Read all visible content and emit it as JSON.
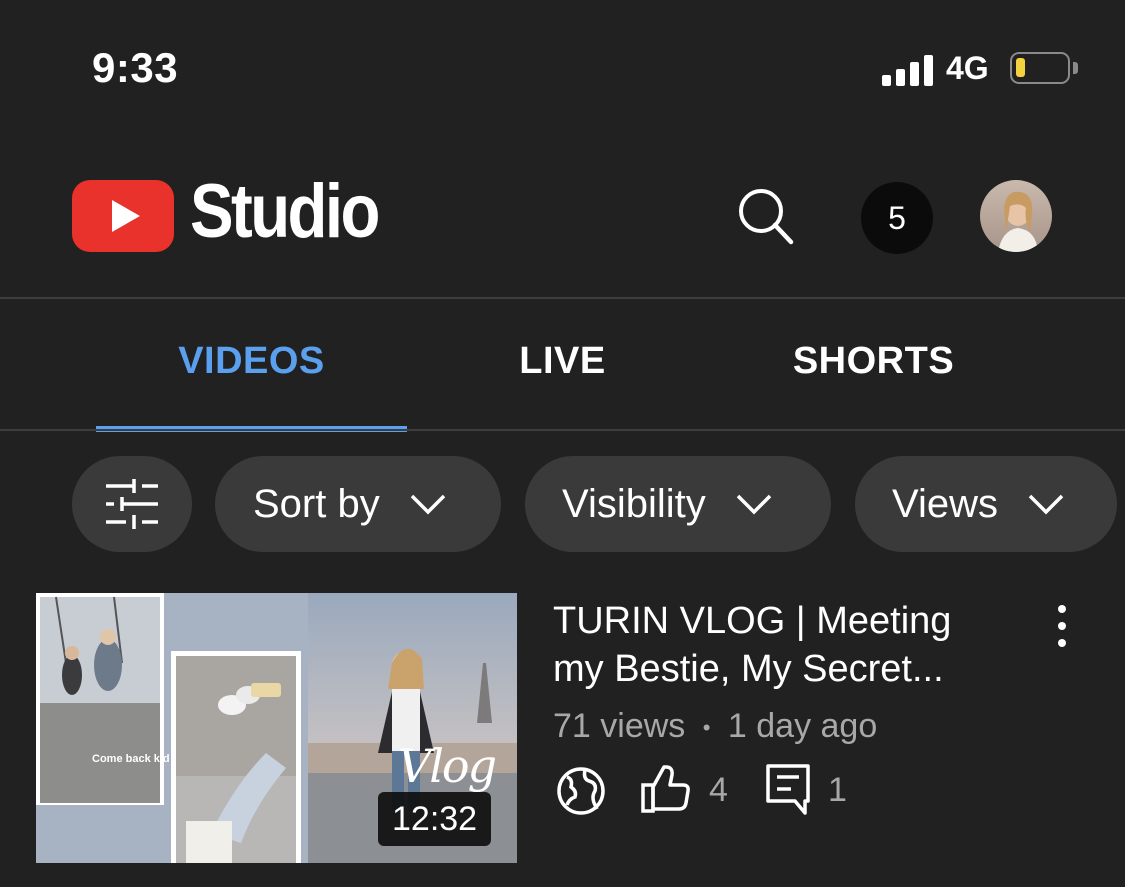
{
  "status_bar": {
    "time": "9:33",
    "network": "4G",
    "signal_bars": 4,
    "battery_level": 0.2,
    "battery_color": "#f4d13e"
  },
  "header": {
    "app_name": "Studio",
    "logo_color": "#e8322b",
    "notification_count": "5"
  },
  "tabs": [
    {
      "label": "VIDEOS",
      "active": true
    },
    {
      "label": "LIVE",
      "active": false
    },
    {
      "label": "SHORTS",
      "active": false
    }
  ],
  "accent_color": "#5aa0ef",
  "filters": {
    "filter_icon": "sliders-icon",
    "chips": [
      {
        "label": "Sort by"
      },
      {
        "label": "Visibility"
      },
      {
        "label": "Views"
      }
    ]
  },
  "videos": [
    {
      "title_line1": "TURIN VLOG | Meeting",
      "title_line2": "my Bestie, My Secret...",
      "views": "71 views",
      "separator": "•",
      "age": "1 day ago",
      "duration": "12:32",
      "visibility_icon": "globe-icon",
      "likes": "4",
      "comments": "1",
      "thumbnail_text_caption": "Come back kid",
      "thumbnail_text_script": "Vlog"
    }
  ]
}
